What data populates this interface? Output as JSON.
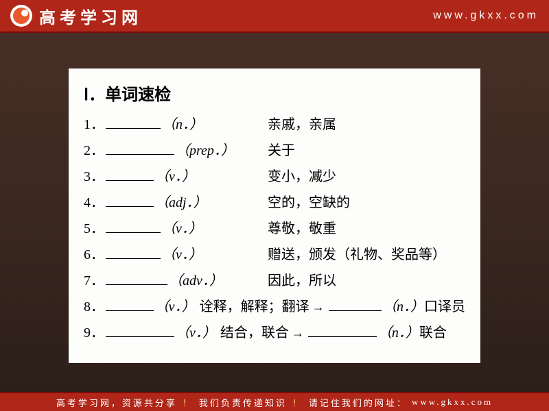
{
  "header": {
    "logo_text": "高考学习网",
    "url": "www.gkxx.com"
  },
  "panel": {
    "title": "Ⅰ．单词速检",
    "items": [
      {
        "num": "1．",
        "pos": "（n．）",
        "def": "亲戚，亲属",
        "blank": "b80",
        "layout": "two-col"
      },
      {
        "num": "2．",
        "pos": "（prep．）",
        "def": "关于",
        "blank": "b100",
        "layout": "two-col"
      },
      {
        "num": "3．",
        "pos": "（v．）",
        "def": "变小，减少",
        "blank": "b70",
        "layout": "two-col"
      },
      {
        "num": "4．",
        "pos": "（adj．）",
        "def": "空的，空缺的",
        "blank": "b70",
        "layout": "two-col"
      },
      {
        "num": "5．",
        "pos": "（v．）",
        "def": "尊敬，敬重",
        "blank": "b80",
        "layout": "two-col"
      },
      {
        "num": "6．",
        "pos": "（v．）",
        "def": "赠送，颁发（礼物、奖品等）",
        "blank": "b80",
        "layout": "two-col"
      },
      {
        "num": "7．",
        "pos": "（adv．）",
        "def": "因此，所以",
        "blank": "b90",
        "layout": "two-col"
      },
      {
        "num": "8．",
        "pos": "（v．）",
        "def": "诠释，解释；翻译",
        "blank": "b90",
        "layout": "flow",
        "arrow": true,
        "blank2": "b100",
        "pos2": "（n．）",
        "def2": "口译员"
      },
      {
        "num": "9．",
        "pos": "（v．）",
        "def": "结合，联合",
        "blank": "b100",
        "layout": "flow",
        "arrow": true,
        "blank2": "b100",
        "pos2": "（n．）",
        "def2": "联合"
      }
    ]
  },
  "footer": {
    "part1": "高考学习网，资源共分享",
    "part2": "我们负责传递知识",
    "part3": "请记住我们的网址：",
    "url": "www.gkxx.com"
  }
}
